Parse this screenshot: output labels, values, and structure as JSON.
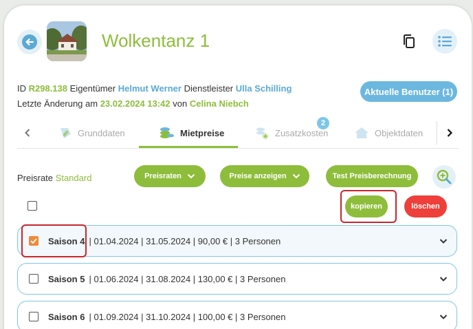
{
  "header": {
    "title": "Wolkentanz 1"
  },
  "meta": {
    "id_label": "ID",
    "id_value": "R298.138",
    "owner_label": "Eigentümer",
    "owner_value": "Helmut Werner",
    "provider_label": "Dienstleister",
    "provider_value": "Ulla Schilling",
    "changed_label": "Letzte Änderung am",
    "changed_date": "23.02.2024 13:42",
    "changed_by_label": "von",
    "changed_by": "Celina Niebch",
    "users_button": "Aktuelle Benutzer (1)"
  },
  "tabs": {
    "items": [
      {
        "label": "Grunddaten",
        "icon": "pencil-icon"
      },
      {
        "label": "Mietpreise",
        "icon": "coins-icon"
      },
      {
        "label": "Zusatzkosten",
        "icon": "coins-add-icon",
        "badge": "2"
      },
      {
        "label": "Objektdaten",
        "icon": "house-icon"
      }
    ],
    "active": "Mietpreise"
  },
  "pricing": {
    "rate_label": "Preisrate",
    "rate_value": "Standard",
    "rates_button": "Preisraten",
    "show_prices_button": "Preise anzeigen",
    "test_button": "Test Preisberechnung",
    "copy_button": "kopieren",
    "delete_button": "löschen"
  },
  "seasons": [
    {
      "name": "Saison 4",
      "details": "| 01.04.2024 | 31.05.2024 | 90,00 € | 3 Personen",
      "checked": true
    },
    {
      "name": "Saison 5",
      "details": "| 01.06.2024 | 31.08.2024 | 130,00 € | 3 Personen",
      "checked": false
    },
    {
      "name": "Saison 6",
      "details": "| 01.09.2024 | 31.10.2024 | 100,00 € | 3 Personen",
      "checked": false
    }
  ],
  "colors": {
    "accent_green": "#8ebd3b",
    "accent_blue": "#6cb7df",
    "danger_red": "#ee3f3a",
    "check_orange": "#ef8a3a",
    "highlight_red": "#c8262b"
  }
}
